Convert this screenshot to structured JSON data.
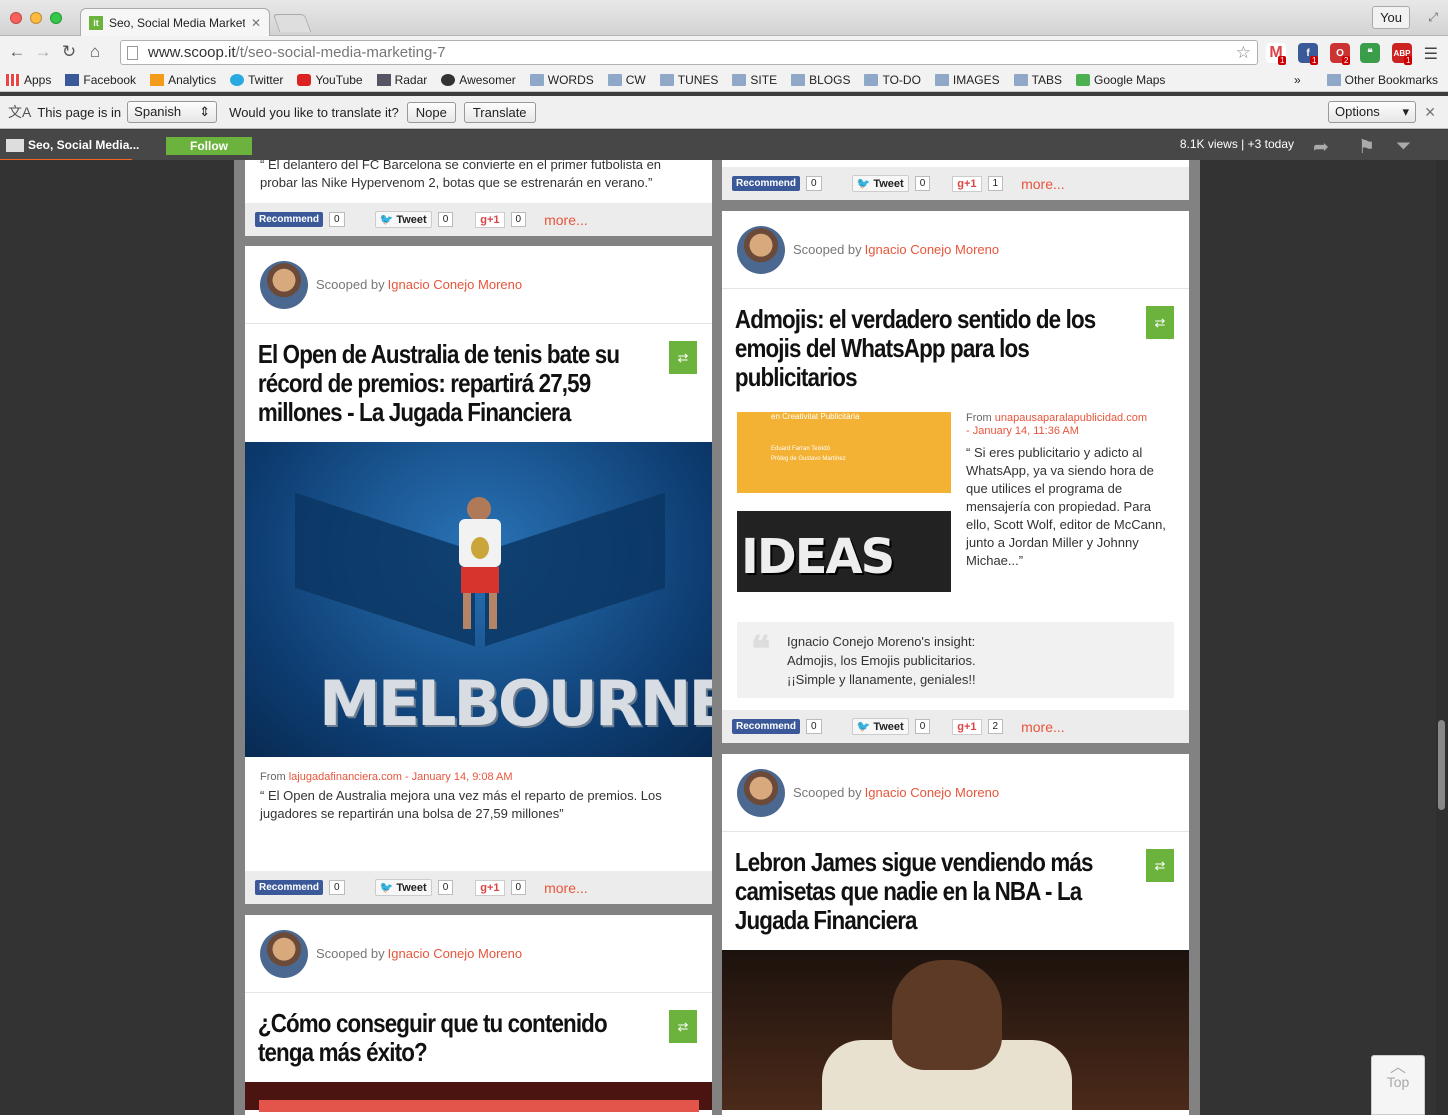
{
  "window": {
    "tab_title": "Seo, Social Media Marketin",
    "tab_favicon": "it",
    "profile": "You"
  },
  "navbar": {
    "url_host": "www.scoop.it",
    "url_path": "/t/seo-social-media-marketing-7",
    "extension_badges": [
      "1",
      "1",
      "2",
      "1"
    ],
    "abp_label": "ABP"
  },
  "bookmarks": {
    "items": [
      "Apps",
      "Facebook",
      "Analytics",
      "Twitter",
      "YouTube",
      "Radar",
      "Awesomer",
      "WORDS",
      "CW",
      "TUNES",
      "SITE",
      "BLOGS",
      "TO-DO",
      "IMAGES",
      "TABS",
      "Google Maps"
    ],
    "overflow": "»",
    "other": "Other Bookmarks"
  },
  "translate_bar": {
    "prefix": "This page is in",
    "language": "Spanish",
    "question": "Would you like to translate it?",
    "nope": "Nope",
    "translate": "Translate",
    "options": "Options"
  },
  "scoop_bar": {
    "topic_title": "Seo, Social Media...",
    "follow": "Follow",
    "views": "8.1K views | +3 today"
  },
  "left_col": {
    "card0": {
      "quote": "“ El delantero del FC Barcelona se convierte en el primer futbolista en probar las Nike Hypervenom 2, botas que se estrenarán en verano.”",
      "counts": {
        "recommend": "0",
        "tweet": "0",
        "plus": "0"
      }
    },
    "card1": {
      "scooped_prefix": "Scooped by",
      "author": "Ignacio Conejo Moreno",
      "title": "El Open de Australia de tenis bate su récord de premios: repartirá 27,59 millones - La Jugada Financiera",
      "image_text": "MELBOURNE",
      "from_prefix": "From",
      "source": "lajugadafinanciera.com",
      "date": "- January 14, 9:08 AM",
      "quote": "“ El Open de Australia mejora una vez más el reparto de premios. Los jugadores se repartirán una bolsa de 27,59 millones”",
      "counts": {
        "recommend": "0",
        "tweet": "0",
        "plus": "0"
      }
    },
    "card2": {
      "scooped_prefix": "Scooped by",
      "author": "Ignacio Conejo Moreno",
      "title": "¿Cómo conseguir que tu contenido tenga más éxito?"
    }
  },
  "right_col": {
    "card0": {
      "counts": {
        "recommend": "0",
        "tweet": "0",
        "plus": "1"
      }
    },
    "card1": {
      "scooped_prefix": "Scooped by",
      "author": "Ignacio Conejo Moreno",
      "title": "Admojis: el verdadero sentido de los emojis del WhatsApp para los publicitarios",
      "image_caption": "en Creativitat Publicitària",
      "image_sub1": "Eduard Farran Teixidó",
      "image_sub2": "Pròleg de Gustavo Martínez",
      "image_text": "IDEAS",
      "from_prefix": "From",
      "source": "unapausaparalapublicidad.com",
      "date": "- January 14, 11:36 AM",
      "quote": "“ Si eres publicitario y adicto al WhatsApp, ya va siendo hora de que utilices el programa de mensajería con propiedad. Para ello, Scott Wolf, editor de McCann, junto a Jordan Miller y Johnny Michae...”",
      "insight_title": "Ignacio Conejo Moreno's insight:",
      "insight_l1": "Admojis, los Emojis publicitarios.",
      "insight_l2": "¡¡Simple y llanamente, geniales!!",
      "counts": {
        "recommend": "0",
        "tweet": "0",
        "plus": "2"
      }
    },
    "card2": {
      "scooped_prefix": "Scooped by",
      "author": "Ignacio Conejo Moreno",
      "title": "Lebron James sigue vendiendo más camisetas que nadie en la NBA - La Jugada Financiera"
    }
  },
  "labels": {
    "recommend": "Recommend",
    "tweet": "Tweet",
    "plus": "+1",
    "more": "more...",
    "top": "Top"
  },
  "colors": {
    "accent_orange": "#e8553b",
    "scoop_green": "#6bb33c",
    "facebook_blue": "#3b5998"
  }
}
